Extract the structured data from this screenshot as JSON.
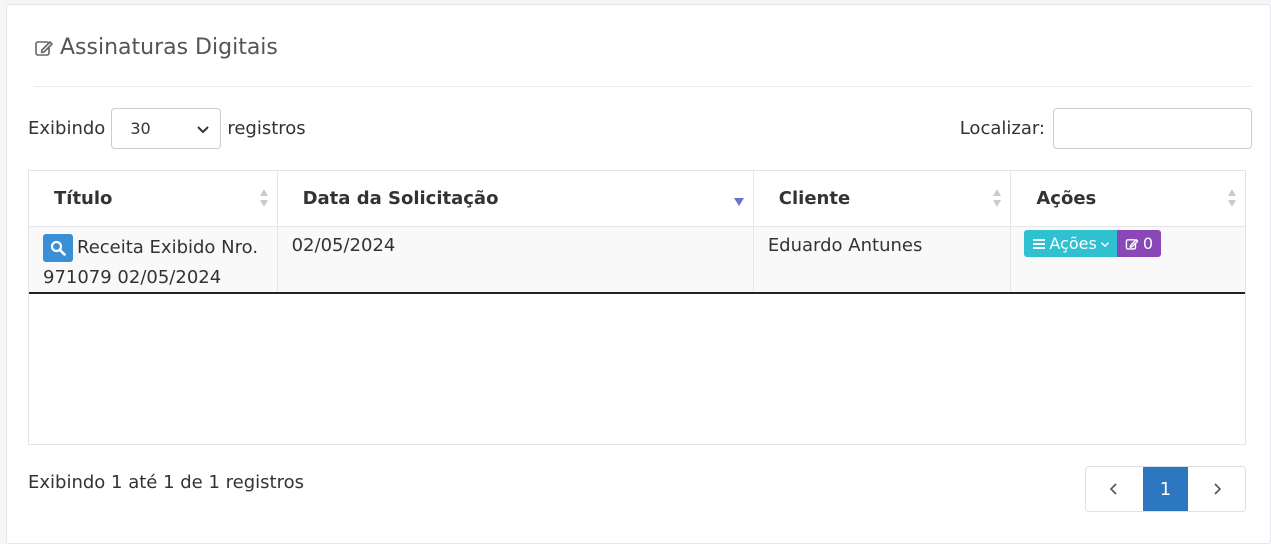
{
  "panel": {
    "title": "Assinaturas Digitais",
    "title_icon": "edit-icon"
  },
  "length": {
    "prefix": "Exibindo",
    "value": "30",
    "suffix": "registros"
  },
  "search": {
    "label": "Localizar:",
    "value": ""
  },
  "table": {
    "columns": [
      "Título",
      "Data da Solicitação",
      "Cliente",
      "Ações"
    ],
    "rows": [
      {
        "titulo": "Receita Exibido Nro. 971079 02/05/2024",
        "data": "02/05/2024",
        "cliente": "Eduardo Antunes",
        "acoes_label": "Ações",
        "sign_count": "0"
      }
    ]
  },
  "info": "Exibindo 1 até 1 de 1 registros",
  "pagination": {
    "current": "1"
  },
  "colors": {
    "primary": "#2c77c0",
    "info": "#2fc1cf",
    "purple": "#8a47b8",
    "view": "#3a8fd6"
  }
}
